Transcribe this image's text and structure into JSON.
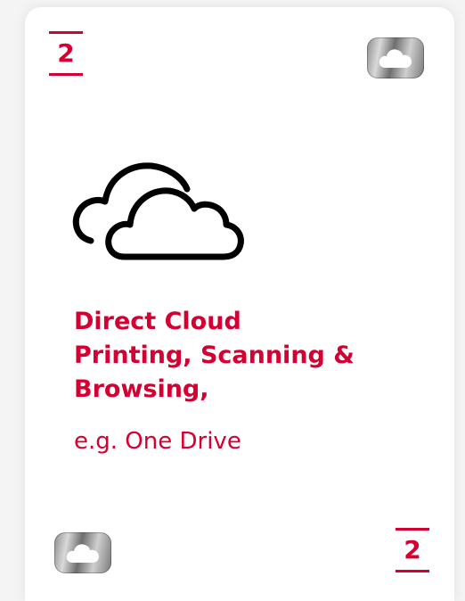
{
  "card": {
    "number_top": "2",
    "number_bottom": "2",
    "icon": "cloud-icon",
    "title_lines": [
      "Direct Cloud",
      "Printing, Scanning &",
      "Browsing,"
    ],
    "subtitle": "e.g. One Drive",
    "accent_color": "#d50032",
    "chip_icon": "cloud-icon"
  }
}
